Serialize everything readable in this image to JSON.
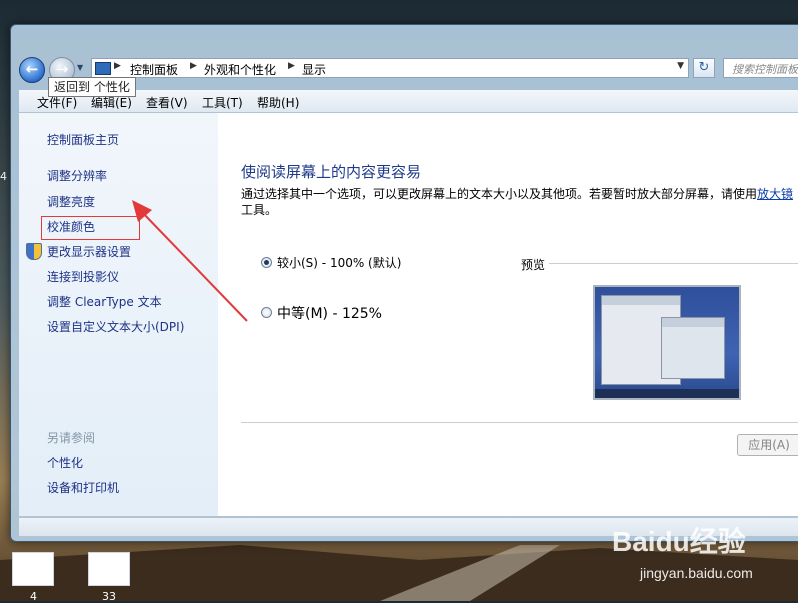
{
  "window": {
    "nav": {
      "back_icon": "back-arrow-icon",
      "forward_icon": "forward-arrow-icon"
    },
    "tooltip": "返回到 个性化",
    "address": {
      "crumbs": [
        "控制面板",
        "外观和个性化",
        "显示"
      ]
    },
    "search_placeholder": "搜索控制面板",
    "menu": [
      "文件(F)",
      "编辑(E)",
      "查看(V)",
      "工具(T)",
      "帮助(H)"
    ]
  },
  "sidebar": {
    "items": [
      "控制面板主页",
      "调整分辨率",
      "调整亮度",
      "校准颜色",
      "更改显示器设置",
      "连接到投影仪",
      "调整 ClearType 文本",
      "设置自定义文本大小(DPI)"
    ],
    "see_also_heading": "另请参阅",
    "see_also": [
      "个性化",
      "设备和打印机"
    ]
  },
  "main": {
    "title": "使阅读屏幕上的内容更容易",
    "description": "通过选择其中一个选项，可以更改屏幕上的文本大小以及其他项。若要暂时放大部分屏幕，请使用",
    "description_link": "放大镜",
    "description_tail": "工具。",
    "options": [
      {
        "label": "较小(S) - 100% (默认)",
        "selected": true
      },
      {
        "label": "中等(M) - 125%",
        "selected": false
      }
    ],
    "preview_label": "预览",
    "apply_button": "应用(A)"
  },
  "desktop": {
    "thumbnails": [
      "4",
      "33"
    ],
    "left_edge_text": "4",
    "watermark": "Baidu经验",
    "watermark_sub": "jingyan.baidu.com"
  },
  "colors": {
    "link": "#1e3287",
    "title": "#1e3a8a",
    "highlight": "#e23a3a"
  }
}
